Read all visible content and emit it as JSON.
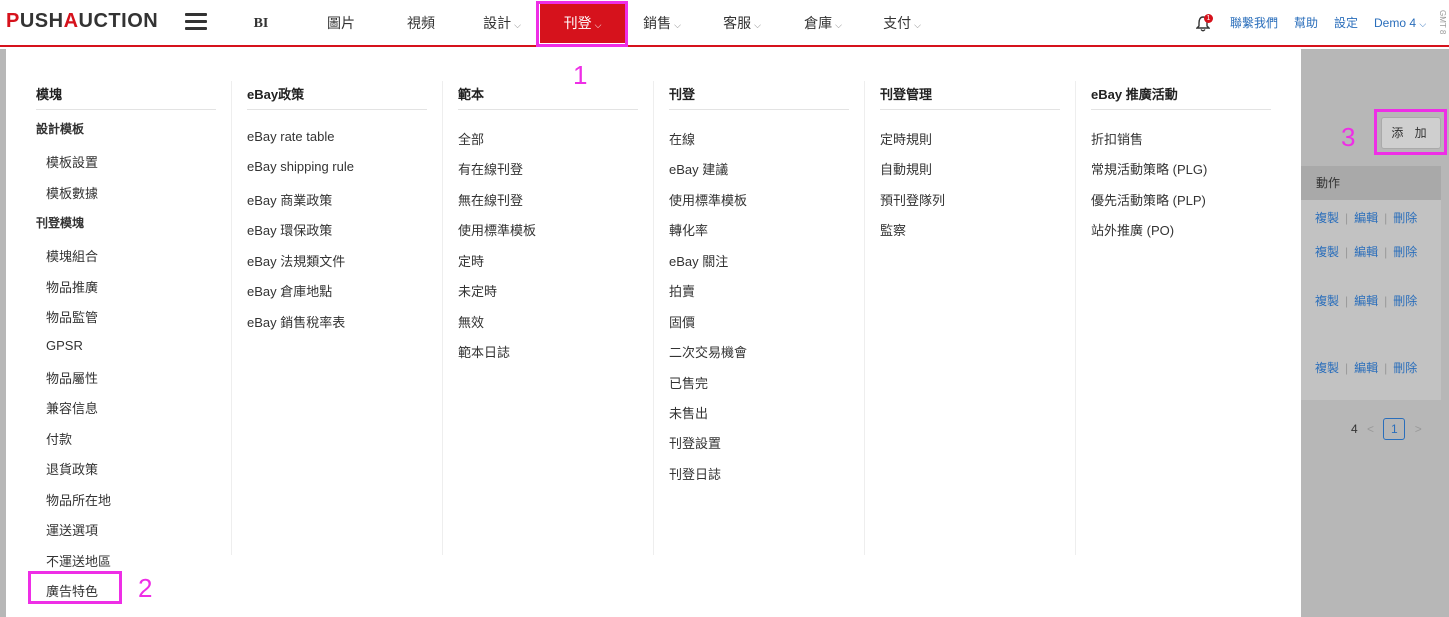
{
  "brand": {
    "logo_p": "P",
    "logo_ush": "USH",
    "logo_a": "A",
    "logo_uction": "UCTION"
  },
  "nav": {
    "items": [
      {
        "label": "BI"
      },
      {
        "label": "圖片"
      },
      {
        "label": "視頻"
      },
      {
        "label": "設計"
      },
      {
        "label": "刊登"
      },
      {
        "label": "銷售"
      },
      {
        "label": "客服"
      },
      {
        "label": "倉庫"
      },
      {
        "label": "支付"
      }
    ],
    "chevron": "⌵",
    "active_index": 4
  },
  "header_right": {
    "bell_badge": "1",
    "contact": "聯繫我們",
    "help": "幫助",
    "settings": "設定",
    "user": "Demo 4",
    "timezone": "GMT 8"
  },
  "menu": {
    "columns": [
      {
        "title": "模塊",
        "items": [
          {
            "label": "設計模板",
            "type": "subheading"
          },
          {
            "label": "模板設置",
            "type": "link"
          },
          {
            "label": "模板數據",
            "type": "link"
          },
          {
            "label": "刊登模塊",
            "type": "subheading"
          },
          {
            "label": "模塊組合",
            "type": "link"
          },
          {
            "label": "物品推廣",
            "type": "link"
          },
          {
            "label": "物品監管",
            "type": "link"
          },
          {
            "label": "GPSR",
            "type": "link"
          },
          {
            "label": "物品屬性",
            "type": "link"
          },
          {
            "label": "兼容信息",
            "type": "link"
          },
          {
            "label": "付款",
            "type": "link"
          },
          {
            "label": "退貨政策",
            "type": "link"
          },
          {
            "label": "物品所在地",
            "type": "link"
          },
          {
            "label": "運送選項",
            "type": "link"
          },
          {
            "label": "不運送地區",
            "type": "link"
          },
          {
            "label": "廣告特色",
            "type": "link"
          }
        ]
      },
      {
        "title": "eBay政策",
        "items": [
          {
            "label": "eBay rate table"
          },
          {
            "label": "eBay shipping rule"
          },
          {
            "label": "eBay 商業政策"
          },
          {
            "label": "eBay 環保政策"
          },
          {
            "label": "eBay 法規類文件"
          },
          {
            "label": "eBay 倉庫地點"
          },
          {
            "label": "eBay 銷售稅率表"
          }
        ]
      },
      {
        "title": "範本",
        "items": [
          {
            "label": "全部"
          },
          {
            "label": "有在線刊登"
          },
          {
            "label": "無在線刊登"
          },
          {
            "label": "使用標準模板"
          },
          {
            "label": "定時"
          },
          {
            "label": "未定時"
          },
          {
            "label": "無效"
          },
          {
            "label": "範本日誌"
          }
        ]
      },
      {
        "title": "刊登",
        "items": [
          {
            "label": "在線"
          },
          {
            "label": "eBay 建議"
          },
          {
            "label": "使用標準模板"
          },
          {
            "label": "轉化率"
          },
          {
            "label": "eBay 關注"
          },
          {
            "label": "拍賣"
          },
          {
            "label": "固價"
          },
          {
            "label": "二次交易機會"
          },
          {
            "label": "已售完"
          },
          {
            "label": "未售出"
          },
          {
            "label": "刊登設置"
          },
          {
            "label": "刊登日誌"
          }
        ]
      },
      {
        "title": "刊登管理",
        "items": [
          {
            "label": "定時規則"
          },
          {
            "label": "自動規則"
          },
          {
            "label": "預刊登隊列"
          },
          {
            "label": "監察"
          }
        ]
      },
      {
        "title": "eBay 推廣活動",
        "items": [
          {
            "label": "折扣销售"
          },
          {
            "label": "常規活動策略 (PLG)"
          },
          {
            "label": "優先活動策略 (PLP)"
          },
          {
            "label": "站外推廣 (PO)"
          }
        ]
      }
    ]
  },
  "background": {
    "add_button": "添 加",
    "table_header": "動作",
    "row_actions": {
      "copy": "複製",
      "edit": "編輯",
      "delete": "刪除"
    },
    "pager": {
      "total": "4",
      "prev": "<",
      "current": "1",
      "next": ">"
    }
  },
  "annotations": {
    "one": "1",
    "two": "2",
    "three": "3"
  },
  "colors": {
    "brand_red": "#d6121c",
    "link_blue": "#2a6ebb",
    "annotation_magenta": "#ee2ee6"
  }
}
